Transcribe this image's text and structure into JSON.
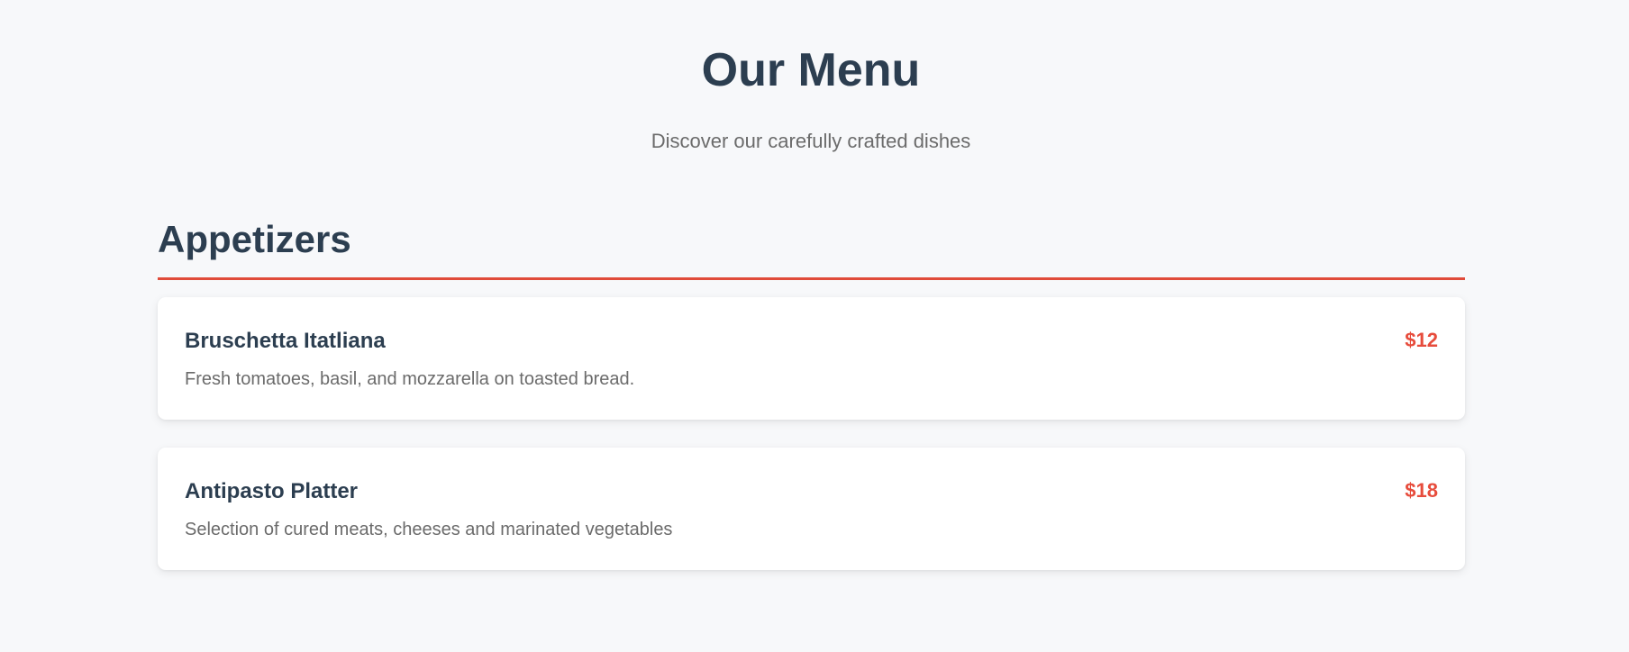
{
  "header": {
    "title": "Our Menu",
    "subtitle": "Discover our carefully crafted dishes"
  },
  "section": {
    "title": "Appetizers",
    "items": [
      {
        "name": "Bruschetta Itatliana",
        "description": "Fresh tomatoes, basil, and mozzarella on toasted bread.",
        "price": "$12"
      },
      {
        "name": "Antipasto Platter",
        "description": "Selection of cured meats, cheeses and marinated vegetables",
        "price": "$18"
      }
    ]
  },
  "colors": {
    "background": "#f7f8fa",
    "heading": "#2c3e50",
    "body_text": "#6b6b6b",
    "accent": "#e74c3c",
    "card_background": "#ffffff"
  }
}
